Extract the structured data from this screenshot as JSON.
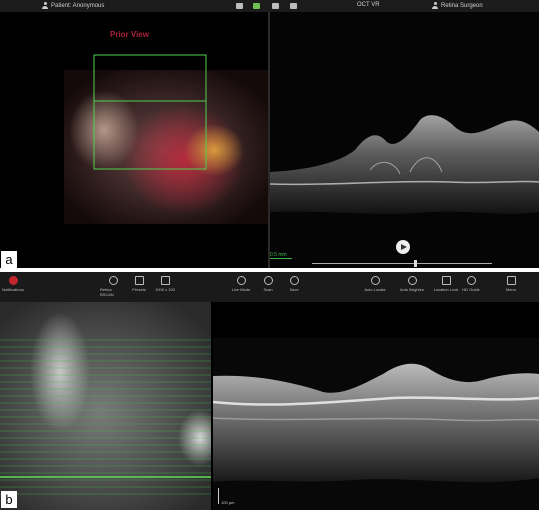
{
  "panel_a": {
    "label": "a",
    "header": {
      "patient": "Patient: Anonymous",
      "mode": "OCT VR",
      "surgeon": "Retina Surgeon"
    },
    "prior_view": "Prior View",
    "scale": "0.5 mm"
  },
  "panel_b": {
    "label": "b",
    "toolbar": {
      "notifications": "Notifications",
      "retina_bscan": "Retina BSCAN",
      "presets": "Presets",
      "size": "1000 x 100",
      "live_mode": "Live Mode",
      "scan": "Scan",
      "save": "Save",
      "auto_locate": "Auto Locate",
      "auto_brighten": "Auto Brighten",
      "location_lock": "Location Lock",
      "hd_guide": "HD Guide",
      "menu": "Menu"
    },
    "scale": "100 µm"
  },
  "colors": {
    "accent_green": "#3fb24a",
    "prior_view_red": "#a8223a",
    "alert_red": "#c0262c"
  }
}
